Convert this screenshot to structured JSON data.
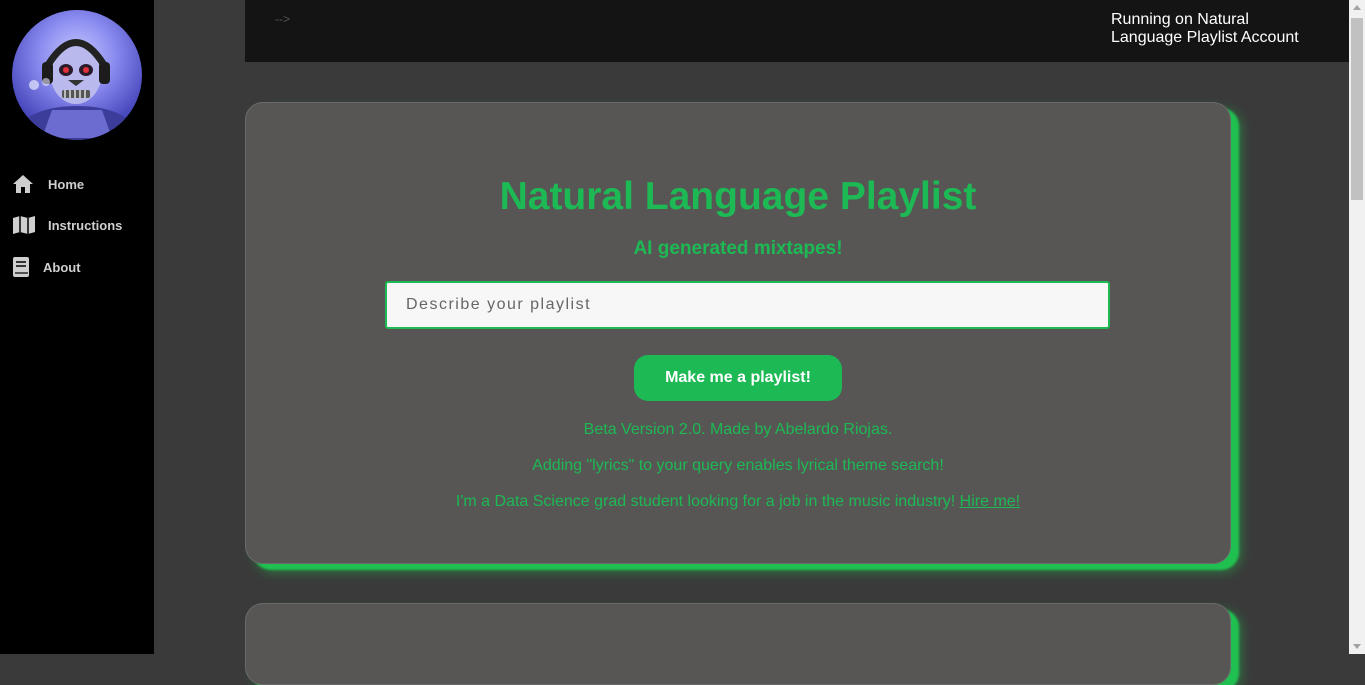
{
  "sidebar": {
    "items": [
      {
        "label": "Home",
        "icon": "home-icon"
      },
      {
        "label": "Instructions",
        "icon": "map-icon"
      },
      {
        "label": "About",
        "icon": "book-icon"
      }
    ]
  },
  "topbar": {
    "arrow_text": "-->",
    "account_text": "Running on Natural Language Playlist Account"
  },
  "main": {
    "title": "Natural Language Playlist",
    "subtitle": "AI generated mixtapes!",
    "search_placeholder": "Describe your playlist",
    "button_label": "Make me a playlist!",
    "version_text": "Beta Version 2.0. Made by Abelardo Riojas.",
    "lyrics_tip": "Adding \"lyrics\" to your query enables lyrical theme search!",
    "hire_text": "I'm a Data Science grad student looking for a job in the music industry!",
    "hire_link": "Hire me!"
  },
  "colors": {
    "accent": "#1db954",
    "sidebar_bg": "#000000",
    "topbar_bg": "#141414",
    "page_bg": "#3a3a3a",
    "card_bg": "#575654"
  }
}
